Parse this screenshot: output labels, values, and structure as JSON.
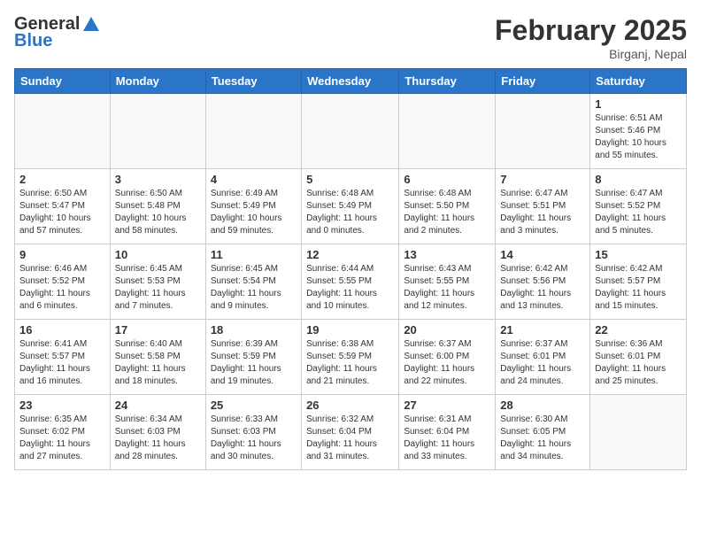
{
  "header": {
    "logo_general": "General",
    "logo_blue": "Blue",
    "month_year": "February 2025",
    "location": "Birganj, Nepal"
  },
  "days_of_week": [
    "Sunday",
    "Monday",
    "Tuesday",
    "Wednesday",
    "Thursday",
    "Friday",
    "Saturday"
  ],
  "weeks": [
    [
      {
        "day": "",
        "info": ""
      },
      {
        "day": "",
        "info": ""
      },
      {
        "day": "",
        "info": ""
      },
      {
        "day": "",
        "info": ""
      },
      {
        "day": "",
        "info": ""
      },
      {
        "day": "",
        "info": ""
      },
      {
        "day": "1",
        "info": "Sunrise: 6:51 AM\nSunset: 5:46 PM\nDaylight: 10 hours and 55 minutes."
      }
    ],
    [
      {
        "day": "2",
        "info": "Sunrise: 6:50 AM\nSunset: 5:47 PM\nDaylight: 10 hours and 57 minutes."
      },
      {
        "day": "3",
        "info": "Sunrise: 6:50 AM\nSunset: 5:48 PM\nDaylight: 10 hours and 58 minutes."
      },
      {
        "day": "4",
        "info": "Sunrise: 6:49 AM\nSunset: 5:49 PM\nDaylight: 10 hours and 59 minutes."
      },
      {
        "day": "5",
        "info": "Sunrise: 6:48 AM\nSunset: 5:49 PM\nDaylight: 11 hours and 0 minutes."
      },
      {
        "day": "6",
        "info": "Sunrise: 6:48 AM\nSunset: 5:50 PM\nDaylight: 11 hours and 2 minutes."
      },
      {
        "day": "7",
        "info": "Sunrise: 6:47 AM\nSunset: 5:51 PM\nDaylight: 11 hours and 3 minutes."
      },
      {
        "day": "8",
        "info": "Sunrise: 6:47 AM\nSunset: 5:52 PM\nDaylight: 11 hours and 5 minutes."
      }
    ],
    [
      {
        "day": "9",
        "info": "Sunrise: 6:46 AM\nSunset: 5:52 PM\nDaylight: 11 hours and 6 minutes."
      },
      {
        "day": "10",
        "info": "Sunrise: 6:45 AM\nSunset: 5:53 PM\nDaylight: 11 hours and 7 minutes."
      },
      {
        "day": "11",
        "info": "Sunrise: 6:45 AM\nSunset: 5:54 PM\nDaylight: 11 hours and 9 minutes."
      },
      {
        "day": "12",
        "info": "Sunrise: 6:44 AM\nSunset: 5:55 PM\nDaylight: 11 hours and 10 minutes."
      },
      {
        "day": "13",
        "info": "Sunrise: 6:43 AM\nSunset: 5:55 PM\nDaylight: 11 hours and 12 minutes."
      },
      {
        "day": "14",
        "info": "Sunrise: 6:42 AM\nSunset: 5:56 PM\nDaylight: 11 hours and 13 minutes."
      },
      {
        "day": "15",
        "info": "Sunrise: 6:42 AM\nSunset: 5:57 PM\nDaylight: 11 hours and 15 minutes."
      }
    ],
    [
      {
        "day": "16",
        "info": "Sunrise: 6:41 AM\nSunset: 5:57 PM\nDaylight: 11 hours and 16 minutes."
      },
      {
        "day": "17",
        "info": "Sunrise: 6:40 AM\nSunset: 5:58 PM\nDaylight: 11 hours and 18 minutes."
      },
      {
        "day": "18",
        "info": "Sunrise: 6:39 AM\nSunset: 5:59 PM\nDaylight: 11 hours and 19 minutes."
      },
      {
        "day": "19",
        "info": "Sunrise: 6:38 AM\nSunset: 5:59 PM\nDaylight: 11 hours and 21 minutes."
      },
      {
        "day": "20",
        "info": "Sunrise: 6:37 AM\nSunset: 6:00 PM\nDaylight: 11 hours and 22 minutes."
      },
      {
        "day": "21",
        "info": "Sunrise: 6:37 AM\nSunset: 6:01 PM\nDaylight: 11 hours and 24 minutes."
      },
      {
        "day": "22",
        "info": "Sunrise: 6:36 AM\nSunset: 6:01 PM\nDaylight: 11 hours and 25 minutes."
      }
    ],
    [
      {
        "day": "23",
        "info": "Sunrise: 6:35 AM\nSunset: 6:02 PM\nDaylight: 11 hours and 27 minutes."
      },
      {
        "day": "24",
        "info": "Sunrise: 6:34 AM\nSunset: 6:03 PM\nDaylight: 11 hours and 28 minutes."
      },
      {
        "day": "25",
        "info": "Sunrise: 6:33 AM\nSunset: 6:03 PM\nDaylight: 11 hours and 30 minutes."
      },
      {
        "day": "26",
        "info": "Sunrise: 6:32 AM\nSunset: 6:04 PM\nDaylight: 11 hours and 31 minutes."
      },
      {
        "day": "27",
        "info": "Sunrise: 6:31 AM\nSunset: 6:04 PM\nDaylight: 11 hours and 33 minutes."
      },
      {
        "day": "28",
        "info": "Sunrise: 6:30 AM\nSunset: 6:05 PM\nDaylight: 11 hours and 34 minutes."
      },
      {
        "day": "",
        "info": ""
      }
    ]
  ]
}
